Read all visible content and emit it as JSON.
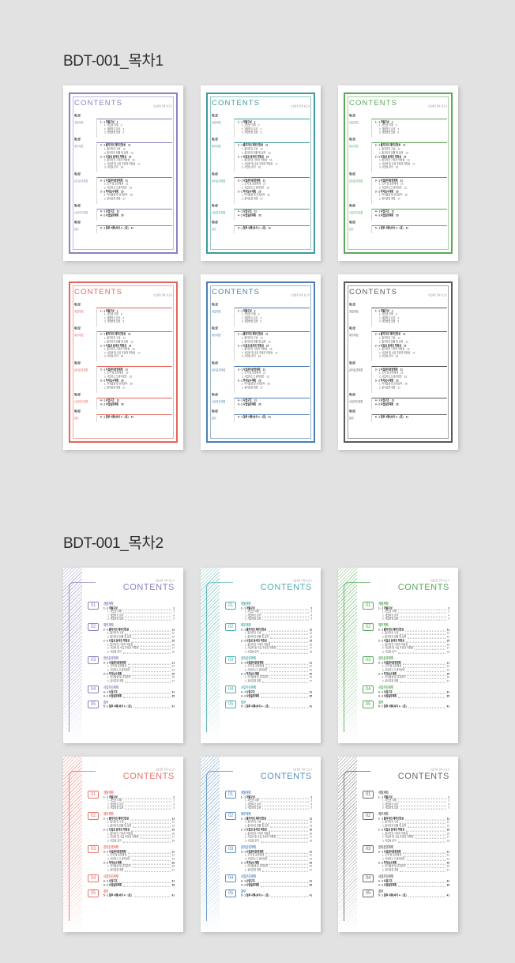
{
  "page": {
    "background_color": "#e2e2e2",
    "divider_color": "#9fb3bd"
  },
  "sections": [
    {
      "title": "BDT-001_목차1",
      "style": "framed"
    },
    {
      "title": "BDT-001_목차2",
      "style": "striped"
    }
  ],
  "card_common": {
    "contents_heading": "CONTENTS",
    "header_sub": "사업계획 전략 보고서",
    "chapter_label_1": "제1장",
    "chapter_label_2": "제2장",
    "chapter_label_3": "제3장",
    "chapter_label_4": "제4장",
    "chapter_label_5": "제5장",
    "badge_1": "01",
    "badge_2": "02",
    "badge_3": "03",
    "badge_4": "04",
    "badge_5": "05"
  },
  "toc": [
    {
      "chapter_label": "제1장",
      "badge": "01",
      "title": "개발계획",
      "groups": [
        {
          "main": {
            "text": "1 - 1 개발구성",
            "page": "2"
          },
          "subs": [
            {
              "text": "1. 사업의 이해",
              "page": "3"
            },
            {
              "text": "2. 개발하기 분석",
              "page": "4"
            },
            {
              "text": "3. 개발방향 설정",
              "page": "5"
            }
          ]
        }
      ]
    },
    {
      "chapter_label": "제2장",
      "badge": "02",
      "title": "재무계획",
      "groups": [
        {
          "main": {
            "text": "2 - 1 출자자의 재무건전성",
            "page": "11"
          },
          "subs": [
            {
              "text": "1. 출자자의 구성",
              "page": "12"
            },
            {
              "text": "2. 출자자의 현황 및 실적",
              "page": "13"
            }
          ]
        },
        {
          "main": {
            "text": "2 - 2 사업성 분석의 적정성",
            "page": "15"
          },
          "subs": [
            {
              "text": "1. 출자자의 기대치 적정성",
              "page": "16"
            },
            {
              "text": "2. 사업비 및 수입 추정의 적정성",
              "page": "17"
            },
            {
              "text": "3. 사업성 분석",
              "page": "18"
            }
          ]
        }
      ]
    },
    {
      "chapter_label": "제3장",
      "badge": "03",
      "title": "관리운영계획",
      "groups": [
        {
          "main": {
            "text": "3 - 1 사업관리운영계획",
            "page": "21"
          },
          "subs": [
            {
              "text": "1. 조직 및 운영체계",
              "page": "22"
            },
            {
              "text": "2. 사업리스크 관리방안",
              "page": "23"
            }
          ]
        },
        {
          "main": {
            "text": "3 - 2 하자보수계획",
            "page": "25"
          },
          "subs": [
            {
              "text": "1. 하자발생 및 유지관리",
              "page": "26"
            },
            {
              "text": "2. 관리운영 계획",
              "page": "27"
            }
          ]
        }
      ]
    },
    {
      "chapter_label": "제4장",
      "badge": "04",
      "title": "사업추진계획",
      "groups": [
        {
          "main": {
            "text": "4 - 1 사업구조",
            "page": "31"
          },
          "subs": []
        },
        {
          "main": {
            "text": "4 - 2 사업일정계획",
            "page": "35"
          },
          "subs": []
        }
      ]
    },
    {
      "chapter_label": "제5장",
      "badge": "05",
      "title": "첨부",
      "groups": [
        {
          "main": {
            "text": "5 - 1 첨부 서류(서식 4 - 1호)",
            "page": "41"
          },
          "subs": []
        }
      ]
    }
  ],
  "cards": {
    "section1": [
      {
        "name": "purple-framed",
        "color": "#8d7fc0"
      },
      {
        "name": "teal-framed",
        "color": "#3e9a9b"
      },
      {
        "name": "green-framed",
        "color": "#5aa85a"
      },
      {
        "name": "red-framed",
        "color": "#e8635a"
      },
      {
        "name": "blue-framed",
        "color": "#4d7fb5"
      },
      {
        "name": "gray-framed",
        "color": "#5a5a5a"
      }
    ],
    "section2": [
      {
        "name": "purple-striped",
        "color": "#8d7fc0"
      },
      {
        "name": "teal-striped",
        "color": "#4fb0ad"
      },
      {
        "name": "green-striped",
        "color": "#5aa85a"
      },
      {
        "name": "red-striped",
        "color": "#e8736a"
      },
      {
        "name": "blue-striped",
        "color": "#5b8fc4"
      },
      {
        "name": "gray-striped",
        "color": "#6a6a6a"
      }
    ]
  }
}
